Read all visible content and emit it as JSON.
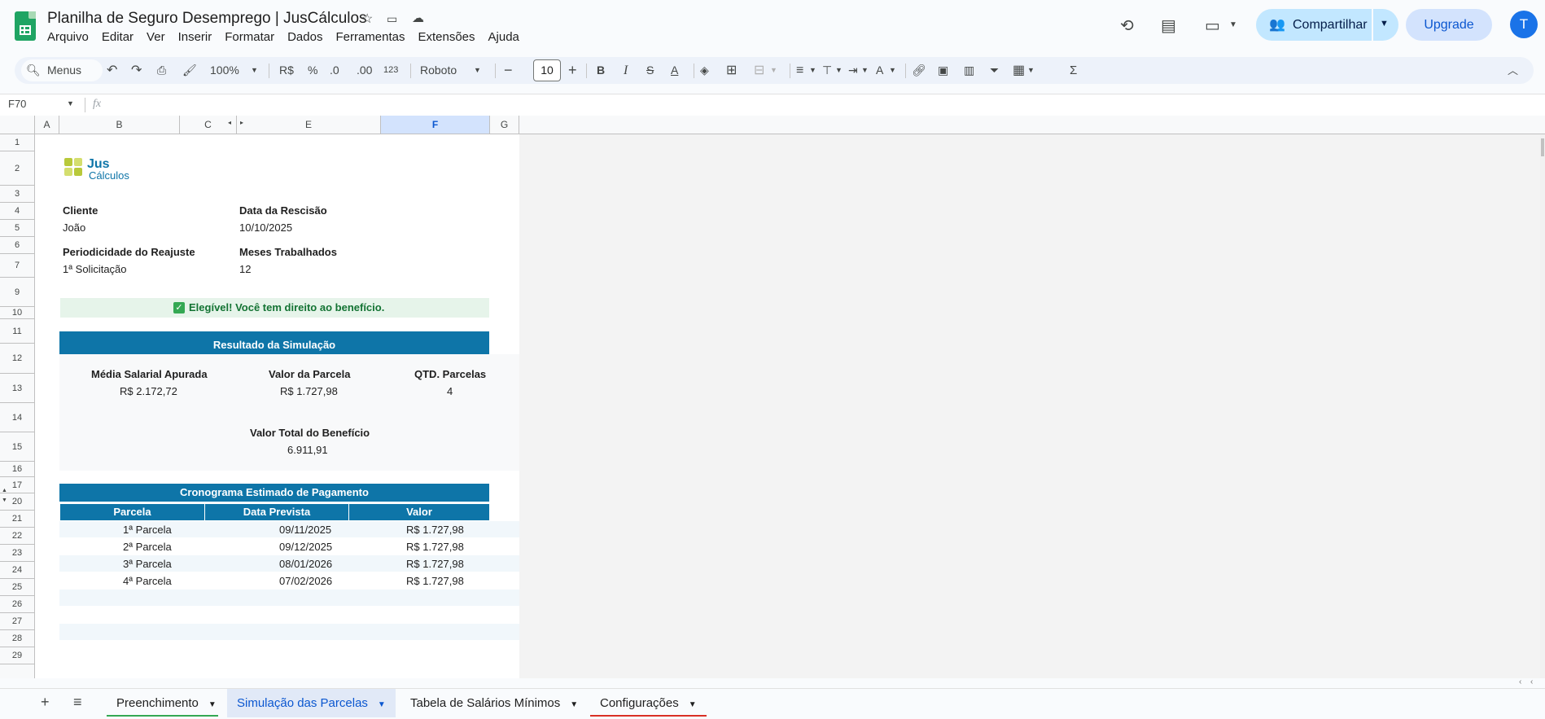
{
  "app": {
    "doc_title": "Planilha de Seguro Desemprego | JusCálculos",
    "menus": [
      "Arquivo",
      "Editar",
      "Ver",
      "Inserir",
      "Formatar",
      "Dados",
      "Ferramentas",
      "Extensões",
      "Ajuda"
    ],
    "share_label": "Compartilhar",
    "upgrade_label": "Upgrade",
    "avatar_letter": "T"
  },
  "toolbar": {
    "search_label": "Menus",
    "zoom": "100%",
    "currency": "R$",
    "percent": "%",
    "dec_dec": ".0",
    "inc_dec": ".00",
    "num_format": "123",
    "font": "Roboto",
    "font_size": "10",
    "bold": "B",
    "italic": "I",
    "sum": "Σ"
  },
  "formula_bar": {
    "name_box": "F70",
    "fx": "fx",
    "content": ""
  },
  "columns": [
    "A",
    "B",
    "C",
    "E",
    "F",
    "G"
  ],
  "rows": [
    "1",
    "2",
    "3",
    "4",
    "5",
    "6",
    "7",
    "9",
    "10",
    "11",
    "12",
    "13",
    "14",
    "15",
    "16",
    "17",
    "20",
    "21",
    "22",
    "23",
    "24",
    "25",
    "26",
    "27",
    "28",
    "29"
  ],
  "sheet": {
    "logo": {
      "top": "Jus",
      "bottom": "Cálculos"
    },
    "cliente_label": "Cliente",
    "cliente_value": "João",
    "rescisao_label": "Data da Rescisão",
    "rescisao_value": "10/10/2025",
    "periodicidade_label": "Periodicidade do Reajuste",
    "periodicidade_value": "1ª  Solicitação",
    "meses_label": "Meses Trabalhados",
    "meses_value": "12",
    "eligible_msg": "Elegível! Você tem direito ao benefício.",
    "resultado_title": "Resultado da Simulação",
    "media_label": "Média Salarial Apurada",
    "media_value": "R$ 2.172,72",
    "parcela_label": "Valor da Parcela",
    "parcela_value": "R$ 1.727,98",
    "qtd_label": "QTD. Parcelas",
    "qtd_value": "4",
    "total_label": "Valor Total do Benefício",
    "total_value": "6.911,91",
    "cronograma_title": "Cronograma Estimado de Pagamento",
    "table_headers": [
      "Parcela",
      "Data Prevista",
      "Valor"
    ],
    "table_rows": [
      [
        "1ª Parcela",
        "09/11/2025",
        "R$ 1.727,98"
      ],
      [
        "2ª Parcela",
        "09/12/2025",
        "R$ 1.727,98"
      ],
      [
        "3ª Parcela",
        "08/01/2026",
        "R$ 1.727,98"
      ],
      [
        "4ª Parcela",
        "07/02/2026",
        "R$ 1.727,98"
      ]
    ]
  },
  "sheet_tabs": [
    "Preenchimento",
    "Simulação das Parcelas",
    "Tabela de Salários Mínimos",
    "Configurações"
  ],
  "active_tab": "Simulação das Parcelas",
  "colors": {
    "accent": "#0e75a8",
    "eligible_bg": "#e6f4ea",
    "eligible_text": "#137333",
    "tab_active": "#0b57d0"
  }
}
